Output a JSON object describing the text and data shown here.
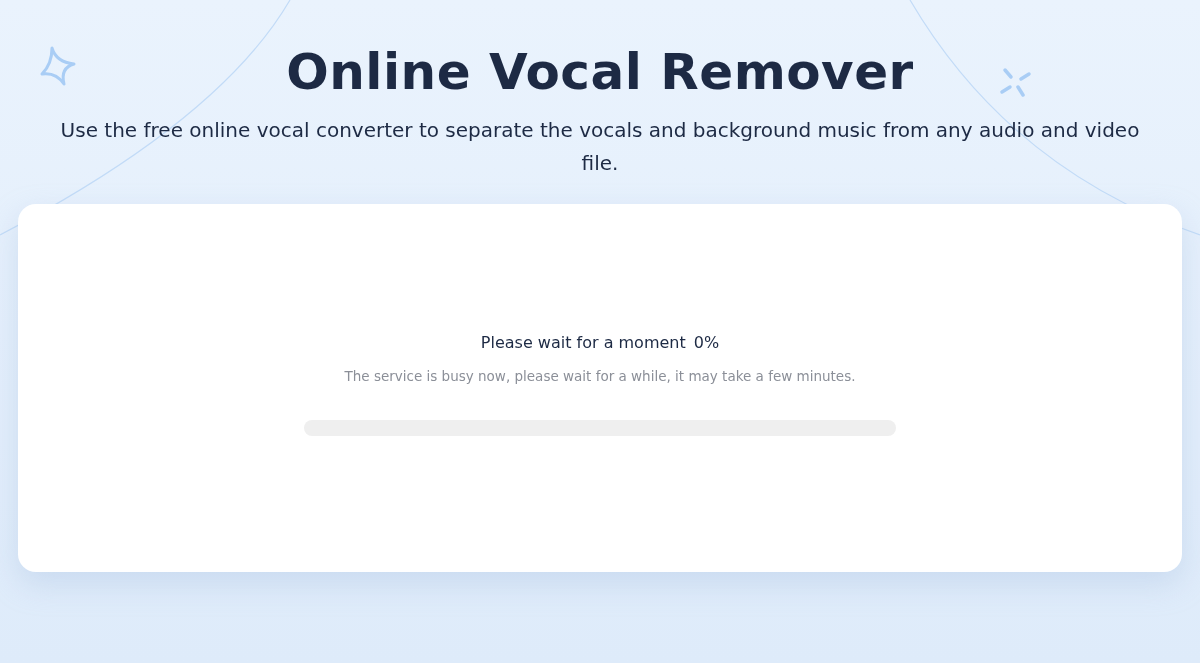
{
  "header": {
    "title": "Online Vocal Remover",
    "subtitle": "Use the free online vocal converter to separate the vocals and background music from any audio and video file."
  },
  "progress": {
    "heading": "Please wait for a moment",
    "percent": "0%",
    "note": "The service is busy now, please wait for a while, it may take a few minutes.",
    "level": 0
  }
}
